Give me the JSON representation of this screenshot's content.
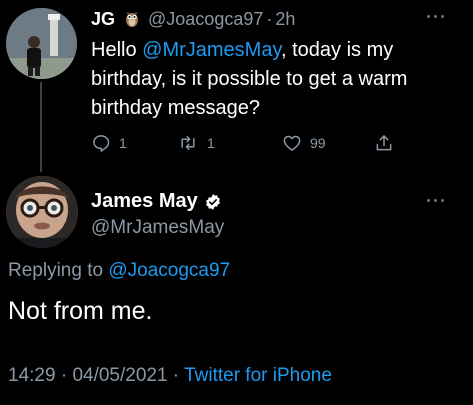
{
  "parent_tweet": {
    "name": "JG",
    "name_emoji_icon": "owl-icon",
    "handle": "@Joacogca97",
    "separator": "·",
    "time": "2h",
    "text_before": "Hello ",
    "mention": "@MrJamesMay",
    "text_after_line1": ", today is my",
    "text_line2": "birthday, is it possible to get a warm",
    "text_line3": "birthday message?",
    "actions": {
      "reply_count": "1",
      "retweet_count": "1",
      "like_count": "99"
    }
  },
  "main_tweet": {
    "name": "James May",
    "verified_icon": "verified-badge-icon",
    "handle": "@MrJamesMay",
    "replying_prefix": "Replying to ",
    "replying_to": "@Joacogca97",
    "text": "Not from me.",
    "time": "14:29",
    "separator1": " · ",
    "date": "04/05/2021",
    "separator2": " · ",
    "source": "Twitter for iPhone"
  },
  "colors": {
    "background": "#000000",
    "text": "#ffffff",
    "secondary": "#8b98a5",
    "link": "#1d9bf0",
    "thread_line": "#38444d"
  }
}
